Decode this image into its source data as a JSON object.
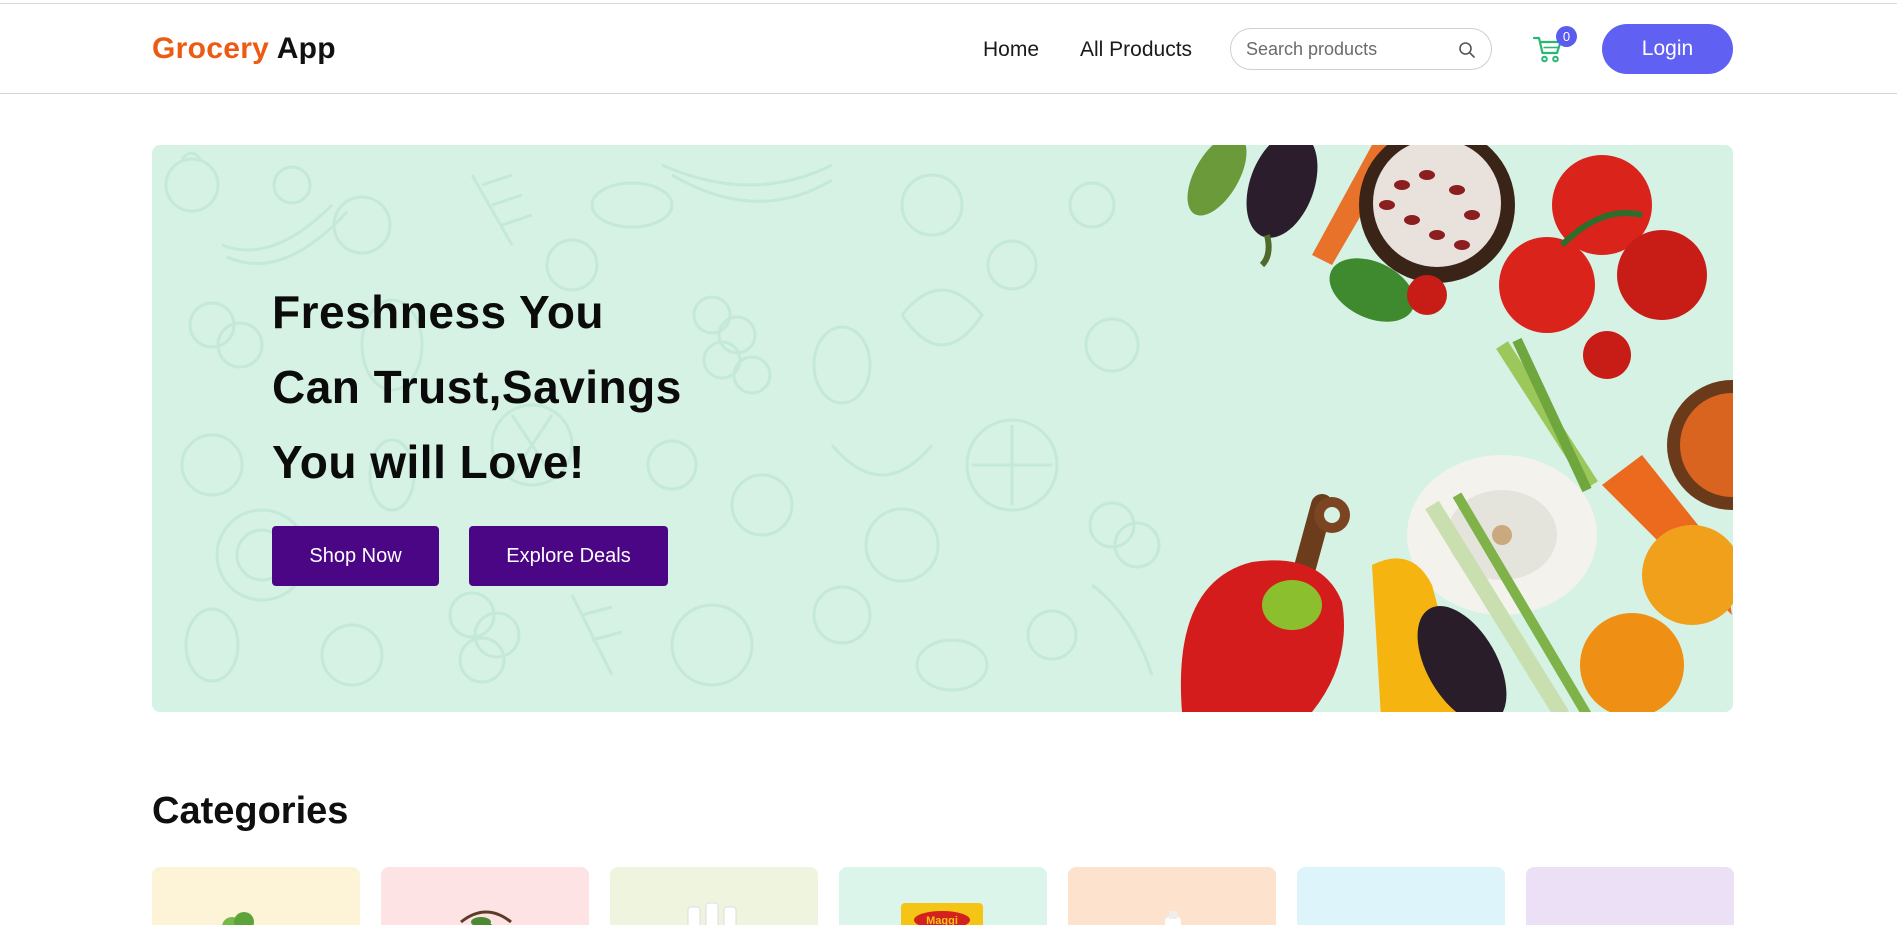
{
  "brand": {
    "part1": "Grocery",
    "part2": "App",
    "color1": "#ec5b13",
    "color2": "#111111"
  },
  "nav": {
    "home": "Home",
    "all_products": "All Products"
  },
  "search": {
    "placeholder": "Search products",
    "icon": "search-icon"
  },
  "cart": {
    "icon": "cart-icon",
    "count": "0",
    "color": "#2bb673"
  },
  "login": {
    "label": "Login",
    "color": "#6060f2"
  },
  "hero": {
    "title_lines": [
      "Freshness You",
      "Can Trust,Savings",
      "You will Love!"
    ],
    "shop_now": "Shop Now",
    "explore_deals": "Explore Deals",
    "background": "#d5f2e5",
    "button_color": "#4b0686"
  },
  "categories": {
    "title": "Categories",
    "cards": [
      {
        "bg": "#fdf3d6",
        "icon": "leafy-greens-icon"
      },
      {
        "bg": "#fde3e3",
        "icon": "fruit-bunch-icon"
      },
      {
        "bg": "#eef4de",
        "icon": "bottles-icon"
      },
      {
        "bg": "#dcf5ea",
        "icon": "instant-noodles-icon",
        "label": "Maggi"
      },
      {
        "bg": "#fde3cd",
        "icon": "dairy-icon"
      },
      {
        "bg": "#ddf4fb",
        "icon": "bakery-icon"
      },
      {
        "bg": "#ece0f7",
        "icon": "grains-icon"
      }
    ]
  }
}
